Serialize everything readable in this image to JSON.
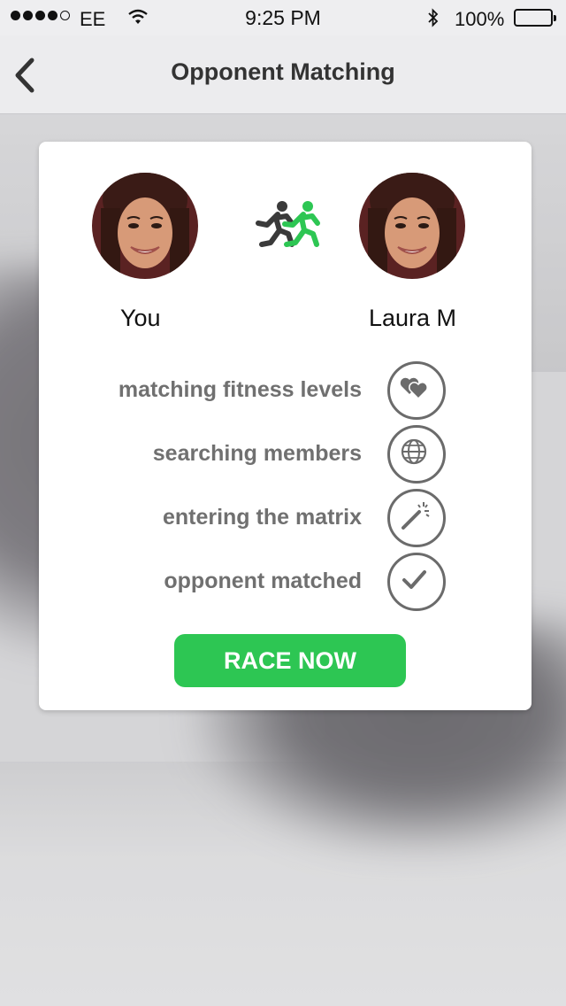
{
  "status_bar": {
    "carrier": "EE",
    "time": "9:25 PM",
    "battery": "100%",
    "signal_bars_filled": 4,
    "signal_bars_total": 5
  },
  "nav": {
    "title": "Opponent Matching",
    "back_icon": "chevron-left-icon"
  },
  "match": {
    "you_label": "You",
    "opponent_label": "Laura M",
    "runners_icon": "two-runners-icon"
  },
  "steps": [
    {
      "label": "matching fitness levels",
      "icon": "hearts-icon"
    },
    {
      "label": "searching members",
      "icon": "globe-icon"
    },
    {
      "label": "entering the matrix",
      "icon": "magic-wand-icon"
    },
    {
      "label": "opponent matched",
      "icon": "checkmark-icon"
    }
  ],
  "action": {
    "race_label": "RACE NOW"
  },
  "colors": {
    "accent": "#2dc653",
    "runner_dark": "#3a3a3a",
    "step_text": "#707070",
    "icon_stroke": "#6b6b6b"
  }
}
